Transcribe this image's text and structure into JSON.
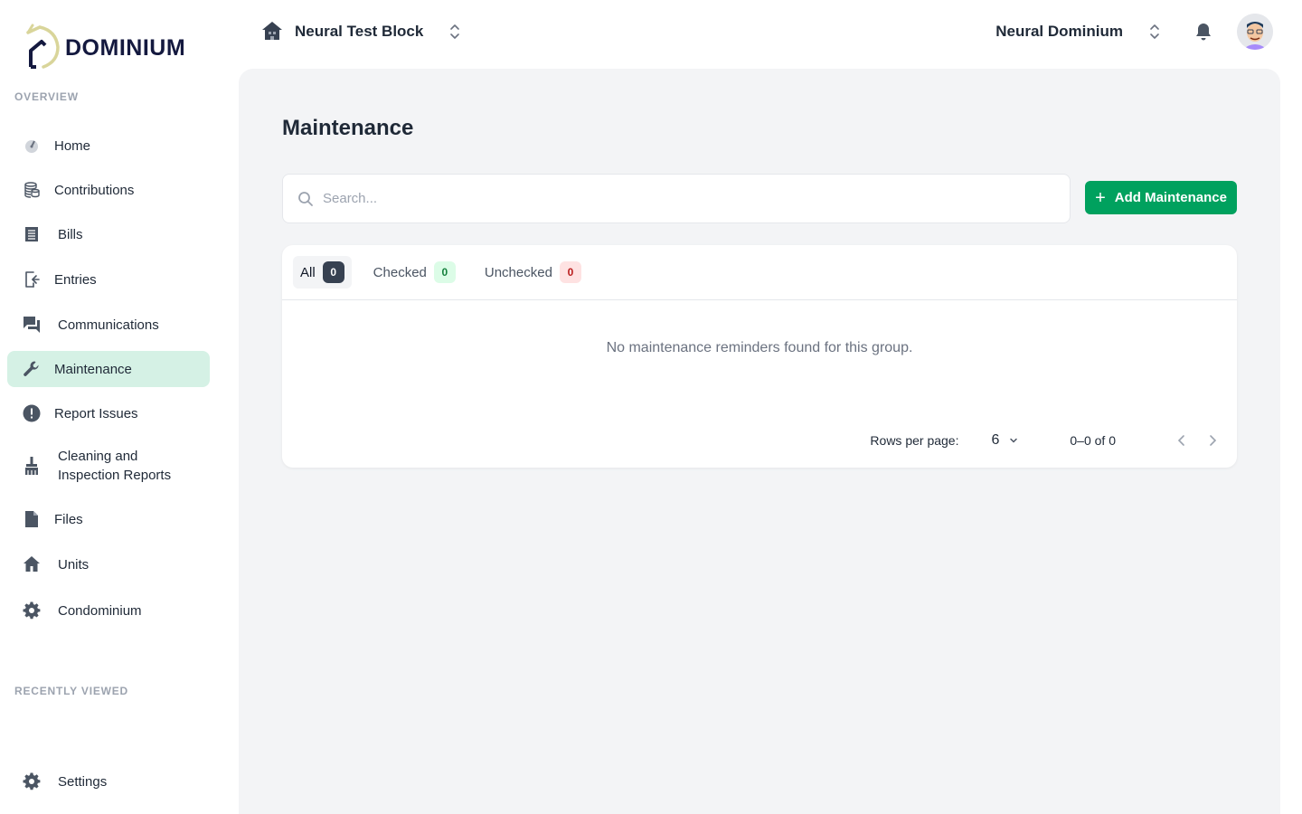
{
  "brand": {
    "name": "Dominium"
  },
  "sidebar": {
    "overview_label": "OVERVIEW",
    "recent_label": "RECENTLY VIEWED",
    "items": [
      {
        "label": "Home",
        "icon": "gauge-icon"
      },
      {
        "label": "Contributions",
        "icon": "coins-icon"
      },
      {
        "label": "Bills",
        "icon": "receipt-icon"
      },
      {
        "label": "Entries",
        "icon": "entry-icon"
      },
      {
        "label": "Communications",
        "icon": "chat-icon"
      },
      {
        "label": "Maintenance",
        "icon": "wrench-icon",
        "active": true
      },
      {
        "label": "Report Issues",
        "icon": "alert-icon"
      },
      {
        "label": "Cleaning and Inspection Reports",
        "icon": "broom-icon"
      },
      {
        "label": "Files",
        "icon": "file-icon"
      },
      {
        "label": "Units",
        "icon": "house-icon"
      },
      {
        "label": "Condominium",
        "icon": "gear-icon"
      }
    ],
    "settings_label": "Settings"
  },
  "header": {
    "block_name": "Neural Test Block",
    "user_name": "Neural Dominium"
  },
  "main": {
    "title": "Maintenance",
    "search_placeholder": "Search...",
    "add_button": "Add Maintenance",
    "tabs": [
      {
        "label": "All",
        "count": "0"
      },
      {
        "label": "Checked",
        "count": "0"
      },
      {
        "label": "Unchecked",
        "count": "0"
      }
    ],
    "empty_message": "No maintenance reminders found for this group.",
    "pagination": {
      "rows_label": "Rows per page:",
      "rows_value": "6",
      "range": "0–0 of 0"
    }
  },
  "colors": {
    "accent": "#00a15e",
    "active_nav": "#d5f1e5",
    "logo_gold": "#d9d59a",
    "logo_navy": "#14193f"
  }
}
